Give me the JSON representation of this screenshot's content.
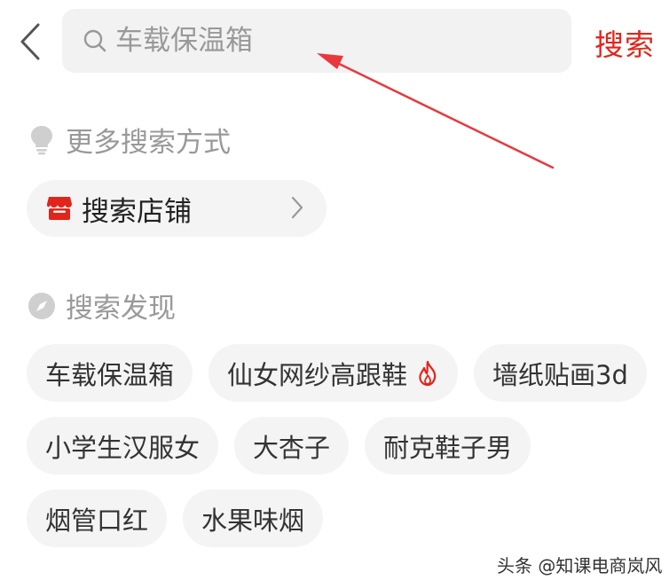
{
  "header": {
    "search_placeholder": "车载保温箱",
    "search_button": "搜索"
  },
  "more_search": {
    "title": "更多搜索方式",
    "shop_label": "搜索店铺"
  },
  "discovery": {
    "title": "搜索发现",
    "tags": [
      {
        "label": "车载保温箱",
        "hot": false
      },
      {
        "label": "仙女网纱高跟鞋",
        "hot": true
      },
      {
        "label": "墙纸贴画3d",
        "hot": false
      },
      {
        "label": "小学生汉服女",
        "hot": false
      },
      {
        "label": "大杏子",
        "hot": false
      },
      {
        "label": "耐克鞋子男",
        "hot": false
      },
      {
        "label": "烟管口红",
        "hot": false
      },
      {
        "label": "水果味烟",
        "hot": false
      }
    ]
  },
  "colors": {
    "accent": "#e1251b",
    "muted": "#999999",
    "pill_bg": "#f4f4f4"
  },
  "icons": {
    "back": "chevron-left-icon",
    "search": "magnifier-icon",
    "more_search": "lightbulb-icon",
    "shop": "storefront-icon",
    "shop_chevron": "chevron-right-icon",
    "discovery": "compass-icon",
    "hot": "flame-icon"
  },
  "watermark": "头条 @知课电商岚风"
}
